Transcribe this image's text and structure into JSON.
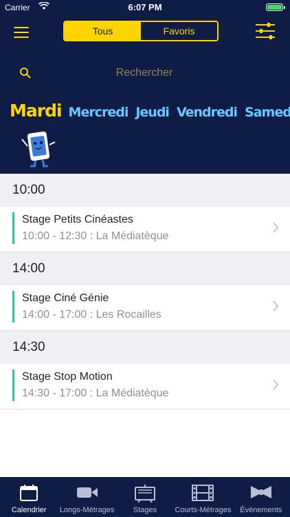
{
  "status_bar": {
    "carrier": "Carrier",
    "time": "6:07 PM"
  },
  "header": {
    "segments": [
      {
        "label": "Tous",
        "active": true
      },
      {
        "label": "Favoris",
        "active": false
      }
    ]
  },
  "search": {
    "placeholder": "Rechercher"
  },
  "days": [
    "Mardi",
    "Mercredi",
    "Jeudi",
    "Vendredi",
    "Samedi"
  ],
  "schedule": [
    {
      "time": "10:00",
      "title": "Stage Petits Cinéastes",
      "details": "10:00 - 12:30 : La Médiatèque"
    },
    {
      "time": "14:00",
      "title": "Stage Ciné Génie",
      "details": "14:00 - 17:00 : Les Rocailles"
    },
    {
      "time": "14:30",
      "title": "Stage Stop Motion",
      "details": "14:30 - 17:00 : La Médiatèque"
    }
  ],
  "tabs": [
    {
      "label": "Calendrier",
      "icon": "calendar-icon",
      "active": true
    },
    {
      "label": "Longs-Métrages",
      "icon": "video-camera-icon",
      "active": false
    },
    {
      "label": "Stages",
      "icon": "board-icon",
      "active": false
    },
    {
      "label": "Courts-Métrages",
      "icon": "film-strip-icon",
      "active": false
    },
    {
      "label": "Évènements",
      "icon": "bow-tie-icon",
      "active": false
    }
  ],
  "colors": {
    "navy": "#0f1c46",
    "yellow": "#ffd400",
    "day_blue": "#69c8ff",
    "accent": "#2fc5a4"
  }
}
